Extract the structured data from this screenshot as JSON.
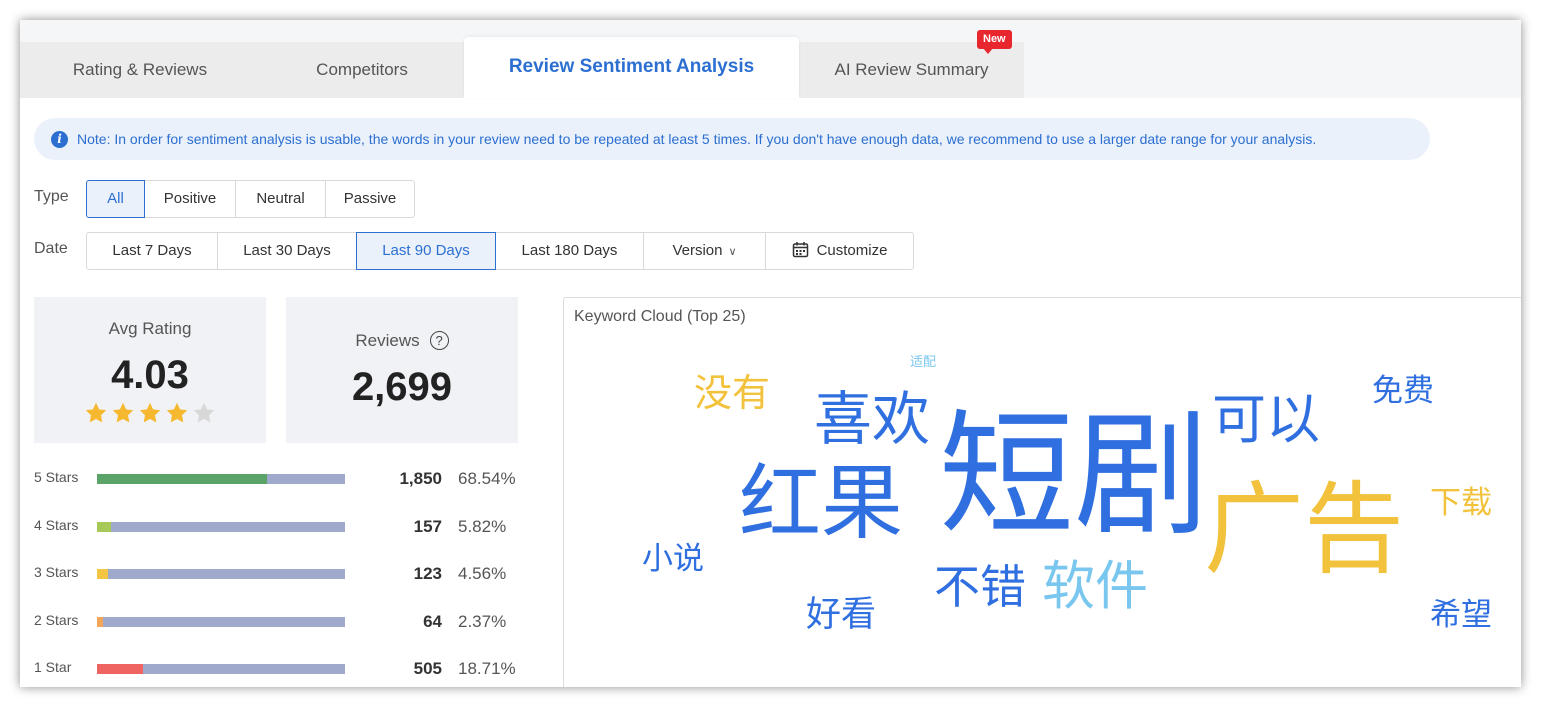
{
  "tabs": [
    {
      "label": "Rating & Reviews"
    },
    {
      "label": "Competitors"
    },
    {
      "label": "Review Sentiment Analysis"
    },
    {
      "label": "AI Review Summary"
    }
  ],
  "new_badge": "New",
  "note": "Note: In order for sentiment analysis is usable, the words in your review need to be repeated at least 5 times. If you don't have enough data, we recommend to use a larger date range for your analysis.",
  "type_filter": {
    "label": "Type",
    "options": [
      "All",
      "Positive",
      "Neutral",
      "Passive"
    ],
    "selected": "All"
  },
  "date_filter": {
    "label": "Date",
    "options": [
      "Last 7 Days",
      "Last 30 Days",
      "Last 90 Days",
      "Last 180 Days",
      "Version",
      "Customize"
    ],
    "selected": "Last 90 Days"
  },
  "avg_rating": {
    "label": "Avg Rating",
    "value": "4.03",
    "stars": 4,
    "max_stars": 5
  },
  "reviews": {
    "label": "Reviews",
    "value": "2,699"
  },
  "distribution": [
    {
      "label": "5 Stars",
      "count": "1,850",
      "percent": "68.54%",
      "fraction": 0.6854,
      "color": "#5aa469"
    },
    {
      "label": "4 Stars",
      "count": "157",
      "percent": "5.82%",
      "fraction": 0.0582,
      "color": "#a7c957"
    },
    {
      "label": "3 Stars",
      "count": "123",
      "percent": "4.56%",
      "fraction": 0.0456,
      "color": "#f4c542"
    },
    {
      "label": "2 Stars",
      "count": "64",
      "percent": "2.37%",
      "fraction": 0.0237,
      "color": "#f2a65a"
    },
    {
      "label": "1 Star",
      "count": "505",
      "percent": "18.71%",
      "fraction": 0.1871,
      "color": "#ef6461"
    }
  ],
  "keyword_cloud": {
    "title": "Keyword Cloud (Top 25)",
    "keywords": [
      {
        "word": "短剧",
        "color": "#2f6fe0"
      },
      {
        "word": "广告",
        "color": "#f2c23c"
      },
      {
        "word": "红果",
        "color": "#2f6fe0"
      },
      {
        "word": "喜欢",
        "color": "#2f6fe0"
      },
      {
        "word": "可以",
        "color": "#2f6fe0"
      },
      {
        "word": "软件",
        "color": "#79c6ef"
      },
      {
        "word": "不错",
        "color": "#2f6fe0"
      },
      {
        "word": "没有",
        "color": "#f2c23c"
      },
      {
        "word": "免费",
        "color": "#2f6fe0"
      },
      {
        "word": "小说",
        "color": "#2f6fe0"
      },
      {
        "word": "好看",
        "color": "#2f6fe0"
      },
      {
        "word": "下载",
        "color": "#f2c23c"
      },
      {
        "word": "希望",
        "color": "#2f6fe0"
      },
      {
        "word": "适配",
        "color": "#79c6ef"
      }
    ]
  },
  "colors": {
    "accent": "#2c6fd1",
    "star_filled": "#f5b82e",
    "star_empty": "#d8d8d8",
    "bar_track": "#9ea9cc"
  }
}
